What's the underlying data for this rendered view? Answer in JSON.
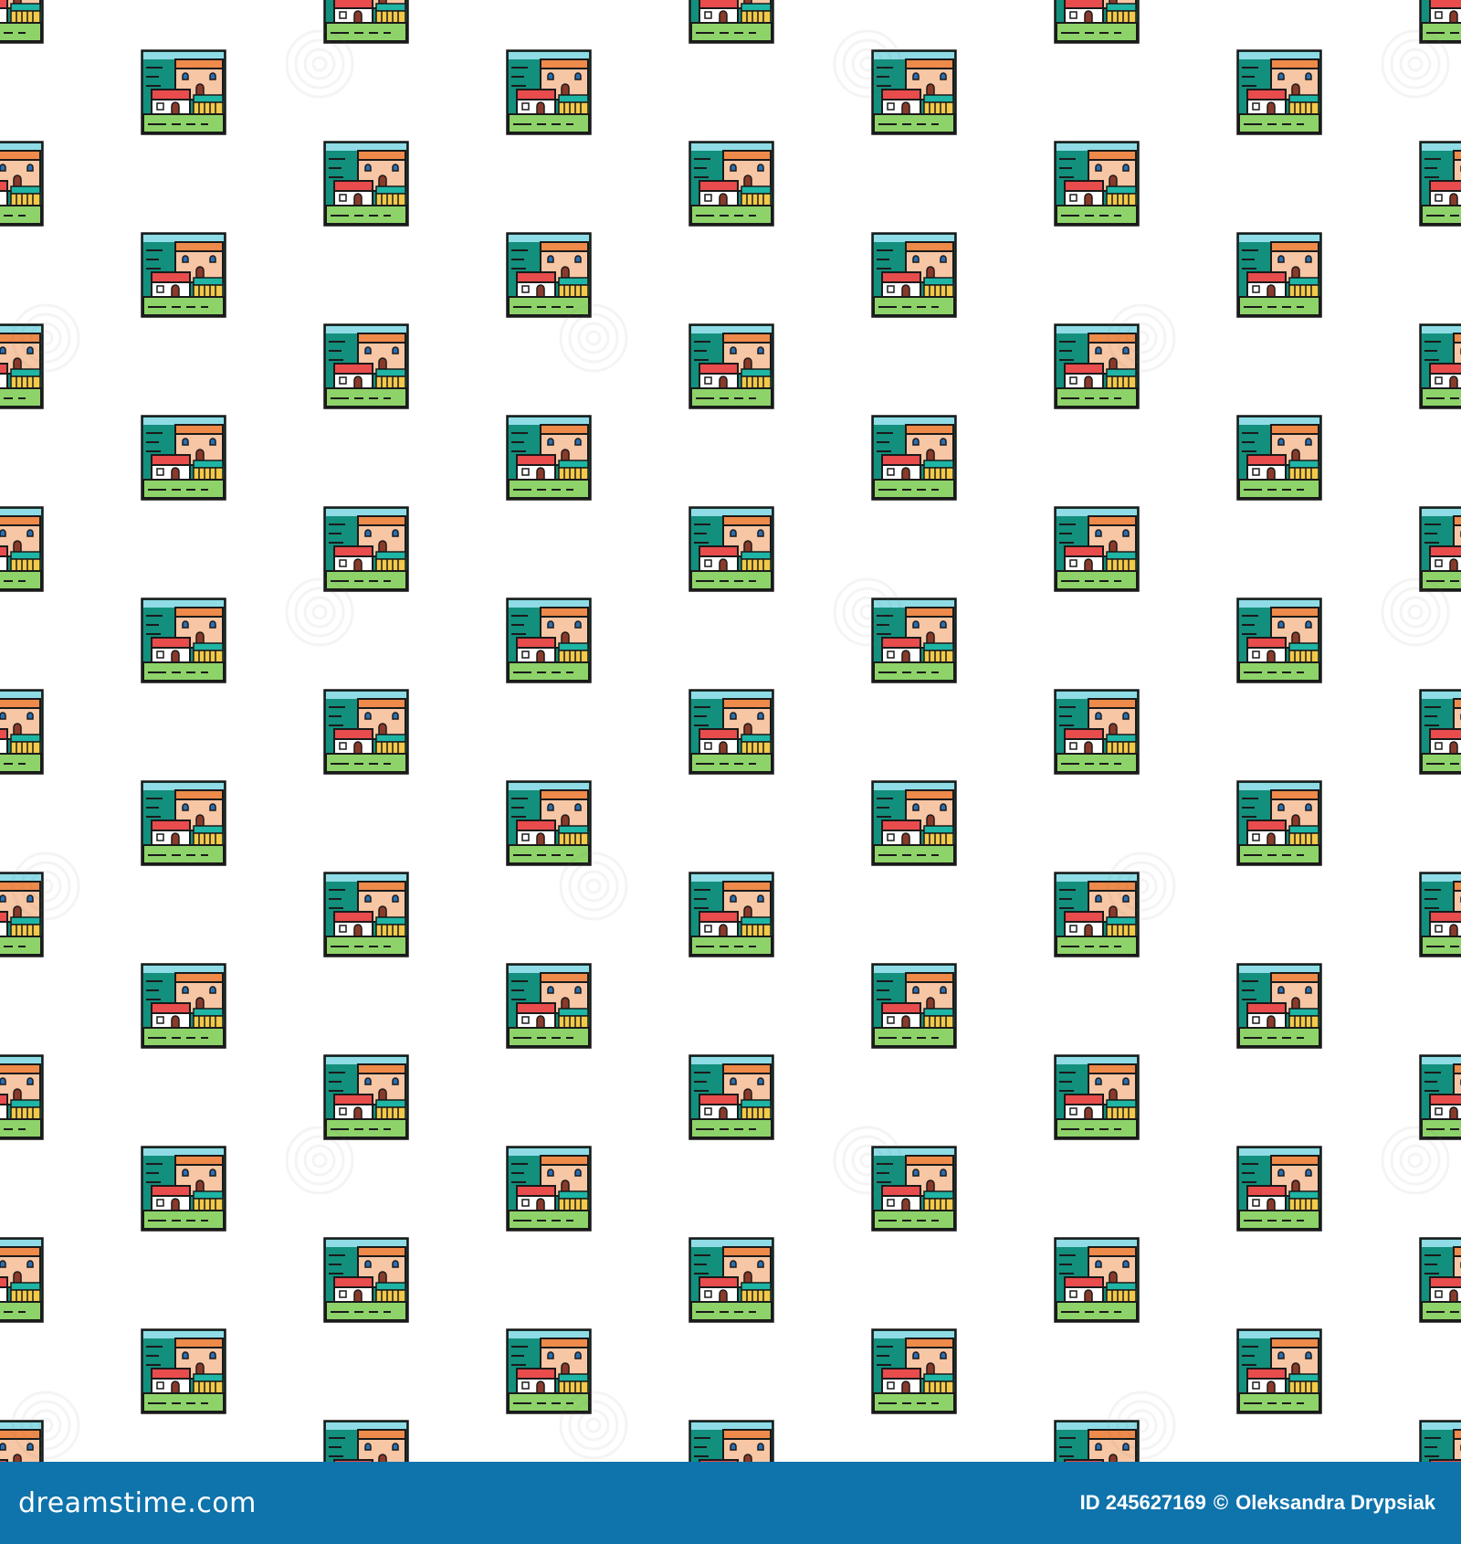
{
  "pattern": {
    "tile_icon": "house-landscape-icon",
    "watermark_icon": "dreamstime-spiral-watermark-icon",
    "colors": {
      "sky": "#8fdce6",
      "sea": "#138f7d",
      "wall": "#f7c6a4",
      "roof": "#ee8a4a",
      "house": "#ffffff",
      "red_roof": "#e84c4c",
      "door": "#8a3a2a",
      "window": "#2b6fb3",
      "fence": "#f3c94a",
      "hedge": "#1fb5a4",
      "grass": "#8ed36a",
      "outline": "#1a1a1a"
    }
  },
  "footer": {
    "brand": "dreamstime.com",
    "id_label": "ID 245627169",
    "copyright_symbol": "©",
    "author": "Oleksandra Drypsiak",
    "background_color": "#0f73ac"
  }
}
